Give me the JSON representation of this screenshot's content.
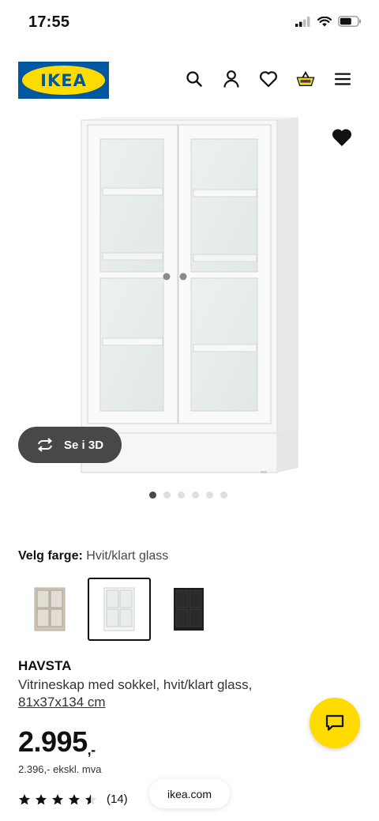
{
  "status_bar": {
    "time": "17:55"
  },
  "header": {
    "logo_text": "IKEA",
    "icons": [
      "search-icon",
      "account-icon",
      "wishlist-icon",
      "cart-icon",
      "menu-icon"
    ]
  },
  "product_image": {
    "view_3d_label": "Se i 3D"
  },
  "carousel": {
    "total": 6,
    "active_index": 0
  },
  "color_picker": {
    "label": "Velg farge:",
    "selected_value": "Hvit/klart glass",
    "swatches": [
      {
        "name": "beige",
        "color": "#cfc6b8",
        "selected": false
      },
      {
        "name": "white",
        "color": "#f4f4f2",
        "selected": true
      },
      {
        "name": "black",
        "color": "#1c1c1c",
        "selected": false
      }
    ]
  },
  "product": {
    "name": "HAVSTA",
    "description": "Vitrineskap med sokkel, hvit/klart glass,",
    "dimensions": "81x37x134 cm",
    "price": "2.995",
    "price_suffix": ",-",
    "price_ex_vat": "2.396,- ekskl. mva",
    "rating": 4.5,
    "review_count": "(14)"
  },
  "browser": {
    "url": "ikea.com"
  },
  "colors": {
    "ikea_blue": "#0058a3",
    "ikea_yellow": "#ffdb00",
    "dark_button": "#484848"
  }
}
